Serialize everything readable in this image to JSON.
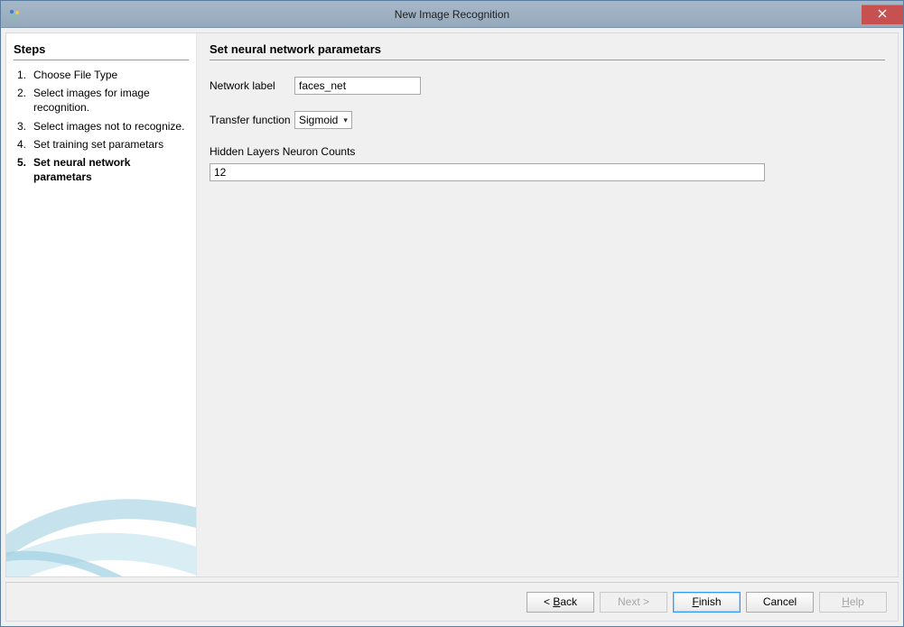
{
  "window": {
    "title": "New Image Recognition"
  },
  "sidebar": {
    "heading": "Steps",
    "steps": [
      {
        "num": "1.",
        "label": "Choose File Type"
      },
      {
        "num": "2.",
        "label": "Select images for image recognition."
      },
      {
        "num": "3.",
        "label": "Select images not to recognize."
      },
      {
        "num": "4.",
        "label": "Set training set parametars"
      },
      {
        "num": "5.",
        "label": "Set neural network parametars"
      }
    ],
    "current_index": 4
  },
  "main": {
    "heading": "Set neural network parametars",
    "network_label_text": "Network label",
    "network_label_value": "faces_net",
    "transfer_function_text": "Transfer function",
    "transfer_function_value": "Sigmoid",
    "hidden_layers_text": "Hidden Layers Neuron Counts",
    "hidden_layers_value": "12"
  },
  "footer": {
    "back": "< Back",
    "next": "Next >",
    "finish": "Finish",
    "cancel": "Cancel",
    "help": "Help"
  }
}
